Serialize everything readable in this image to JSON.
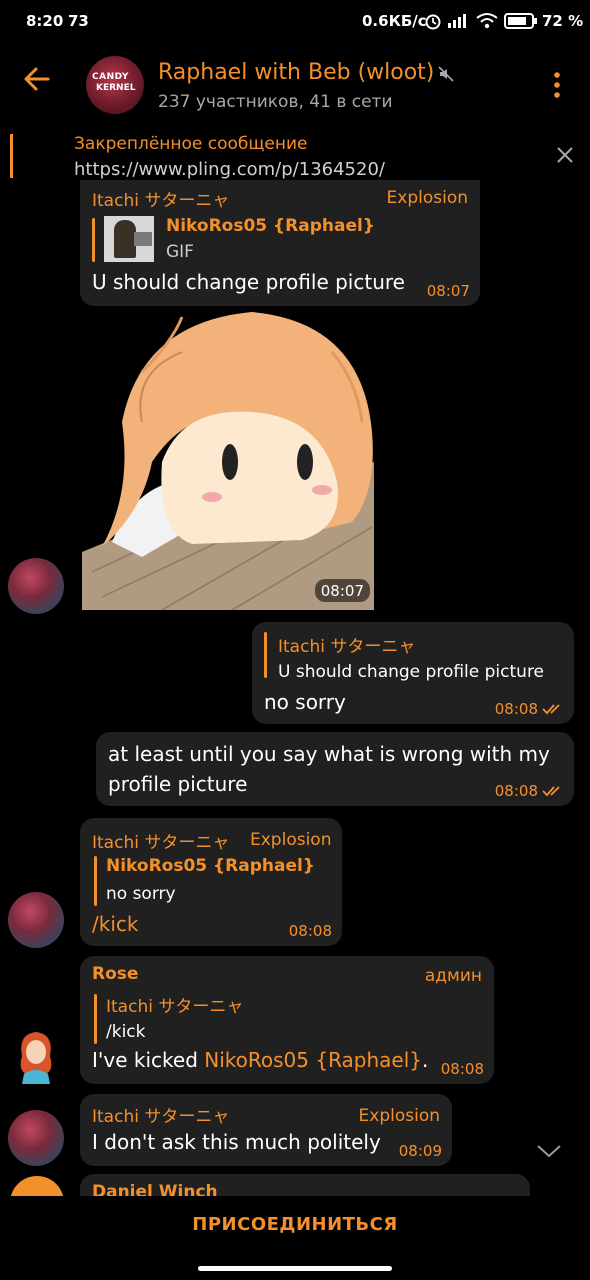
{
  "status_bar": {
    "time": "8:20",
    "extra": "73",
    "net_speed": "0.6КБ/с",
    "battery": "72 %"
  },
  "header": {
    "group_avatar_text_1": "CANDY",
    "group_avatar_text_2": "KERNEL",
    "title": "Raphael with Beb (wloot)",
    "subtitle": "237 участников, 41 в сети"
  },
  "pinned": {
    "label": "Закреплённое сообщение",
    "link": "https://www.pling.com/p/1364520/"
  },
  "messages": {
    "m1": {
      "sender": "Itachi サターニャ",
      "tag": "Explosion",
      "reply_name": "NikoRos05 {Raphael}",
      "reply_text": "GIF",
      "text": "U should change profile picture",
      "time": "08:07"
    },
    "m2": {
      "time": "08:07"
    },
    "m3": {
      "reply_name": "Itachi サターニャ",
      "reply_text": "U should change profile picture",
      "text": "no sorry",
      "time": "08:08"
    },
    "m4": {
      "text_line1": "at least until you say what is wrong with my",
      "text_line2": "profile picture",
      "time": "08:08"
    },
    "m5": {
      "sender": "Itachi サターニャ",
      "tag": "Explosion",
      "reply_name": "NikoRos05 {Raphael}",
      "reply_text": "no sorry",
      "text": "/kick",
      "time": "08:08"
    },
    "m6": {
      "sender": "Rose",
      "tag": "админ",
      "reply_name": "Itachi サターニャ",
      "reply_text": "/kick",
      "text_prefix": "I've kicked ",
      "text_mention": "NikoRos05 {Raphael}",
      "text_suffix": ".",
      "time": "08:08"
    },
    "m7": {
      "sender": "Itachi サターニャ",
      "tag": "Explosion",
      "text": "I don't ask this much politely",
      "time": "08:09"
    },
    "m8": {
      "sender": "Daniel Winch"
    }
  },
  "join_button": "ПРИСОЕДИНИТЬСЯ",
  "colors": {
    "accent": "#f4902b",
    "bubble": "#202020",
    "background": "#000000"
  }
}
